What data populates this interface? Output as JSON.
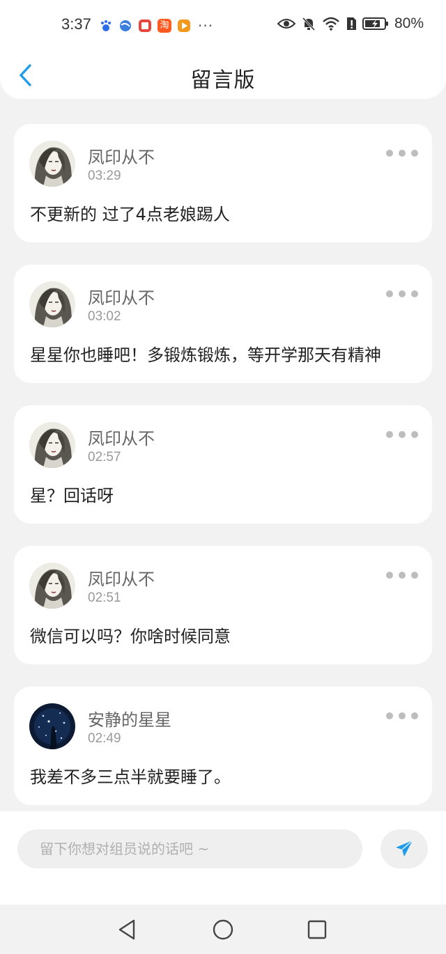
{
  "status_bar": {
    "time": "3:37",
    "more": "···",
    "battery": "80%",
    "icons": [
      "baidu-icon",
      "browser-icon",
      "book-app-icon",
      "taobao-icon",
      "video-app-icon",
      "eye-icon",
      "bell-muted-icon",
      "wifi-icon",
      "sim-alert-icon",
      "battery-icon"
    ],
    "taobao_text": "淘"
  },
  "header": {
    "title": "留言版",
    "back_icon": "chevron-left-icon"
  },
  "messages": [
    {
      "author": "凤印从不",
      "time": "03:29",
      "text": "不更新的 过了4点老娘踢人",
      "avatar": "sketch-girl-avatar"
    },
    {
      "author": "凤印从不",
      "time": "03:02",
      "text": "星星你也睡吧！多锻炼锻炼，等开学那天有精神",
      "avatar": "sketch-girl-avatar"
    },
    {
      "author": "凤印从不",
      "time": "02:57",
      "text": "星？回话呀",
      "avatar": "sketch-girl-avatar"
    },
    {
      "author": "凤印从不",
      "time": "02:51",
      "text": "微信可以吗？你啥时候同意",
      "avatar": "sketch-girl-avatar"
    },
    {
      "author": "安静的星星",
      "time": "02:49",
      "text": "我差不多三点半就要睡了。",
      "avatar": "starry-night-avatar"
    }
  ],
  "composer": {
    "placeholder": "留下你想对组员说的话吧 ~",
    "value": "",
    "send_icon": "paper-plane-icon"
  },
  "colors": {
    "accent": "#1e9be9",
    "background": "#f2f2f2",
    "card": "#ffffff"
  }
}
